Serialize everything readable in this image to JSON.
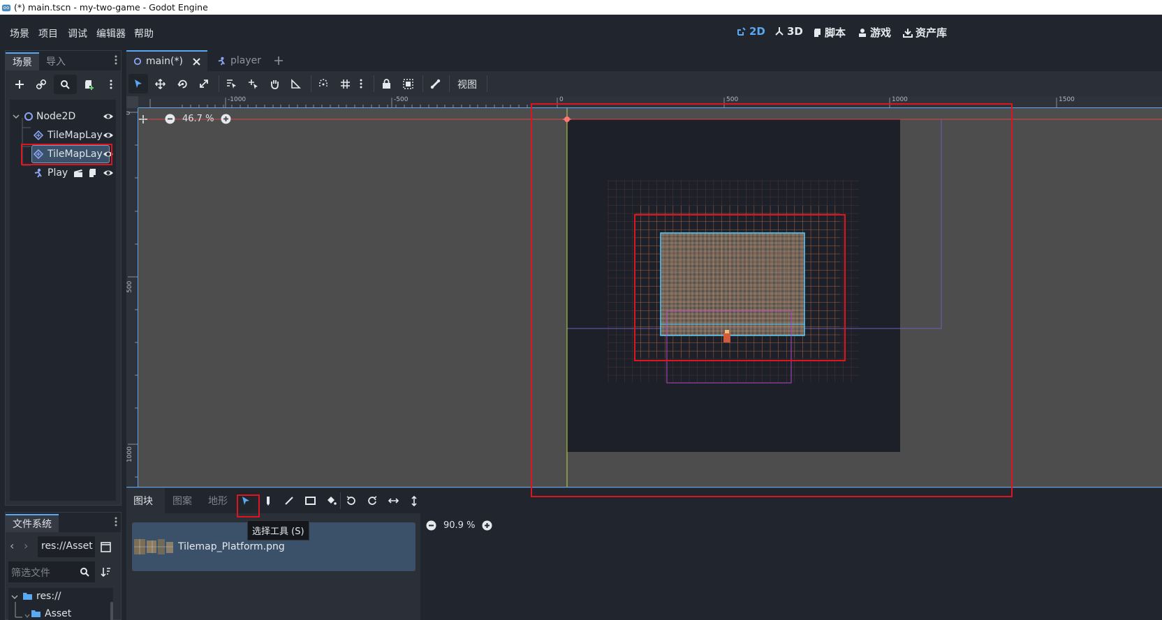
{
  "window": {
    "title": "(*) main.tscn - my-two-game - Godot Engine"
  },
  "menu": [
    "场景",
    "项目",
    "调试",
    "编辑器",
    "帮助"
  ],
  "workspaces": [
    {
      "label": "2D",
      "active": true,
      "icon": "2d-icon"
    },
    {
      "label": "3D",
      "active": false,
      "icon": "3d-icon"
    },
    {
      "label": "脚本",
      "active": false,
      "icon": "script-icon"
    },
    {
      "label": "游戏",
      "active": false,
      "icon": "game-icon"
    },
    {
      "label": "资产库",
      "active": false,
      "icon": "assetlib-icon"
    }
  ],
  "scene_dock": {
    "tabs": [
      "场景",
      "导入"
    ],
    "tree": [
      {
        "label": "Node2D",
        "icon": "node2d-icon"
      },
      {
        "label": "TileMapLay",
        "icon": "tilemaplayer-icon"
      },
      {
        "label": "TileMapLay",
        "icon": "tilemaplayer-icon",
        "selected": true
      },
      {
        "label": "Play",
        "icon": "player-icon"
      }
    ]
  },
  "filesystem_dock": {
    "title": "文件系统",
    "path": "res://Asset",
    "filter_placeholder": "筛选文件",
    "tree": [
      "res://",
      "Asset"
    ]
  },
  "editor": {
    "tabs": [
      {
        "label": "main(*)",
        "active": true
      },
      {
        "label": "player",
        "active": false
      }
    ],
    "view_menu": "视图",
    "zoom": "46.7 %",
    "ruler_top_labels": [
      "-1000",
      "-500",
      "0",
      "500",
      "1000",
      "1500"
    ],
    "ruler_left_labels": [
      "0",
      "500",
      "1000"
    ]
  },
  "tilemap_panel": {
    "tabs": [
      "图块",
      "图案",
      "地形"
    ],
    "tooltip": "选择工具 (S)",
    "tileset_item": "Tilemap_Platform.png",
    "zoom": "90.9 %"
  },
  "colors": {
    "accent": "#5aa7f2",
    "highlight_box": "#e0141e",
    "selected_bg": "#3b5069"
  }
}
